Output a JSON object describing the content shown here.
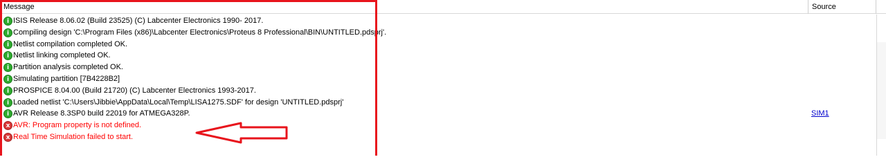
{
  "header": {
    "message_label": "Message",
    "source_label": "Source"
  },
  "messages": [
    {
      "type": "info",
      "text": "ISIS Release 8.06.02 (Build 23525) (C) Labcenter Electronics 1990- 2017.",
      "source": ""
    },
    {
      "type": "info",
      "text": "Compiling design 'C:\\Program Files (x86)\\Labcenter Electronics\\Proteus 8 Professional\\BIN\\UNTITLED.pdsprj'.",
      "source": ""
    },
    {
      "type": "info",
      "text": "Netlist compilation completed OK.",
      "source": ""
    },
    {
      "type": "info",
      "text": "Netlist linking completed OK.",
      "source": ""
    },
    {
      "type": "info",
      "text": "Partition analysis completed OK.",
      "source": ""
    },
    {
      "type": "info",
      "text": "Simulating partition [7B4228B2]",
      "source": ""
    },
    {
      "type": "info",
      "text": "PROSPICE 8.04.00 (Build 21720) (C) Labcenter Electronics 1993-2017.",
      "source": ""
    },
    {
      "type": "info",
      "text": "Loaded netlist 'C:\\Users\\Jibbie\\AppData\\Local\\Temp\\LISA1275.SDF' for design 'UNTITLED.pdsprj'",
      "source": ""
    },
    {
      "type": "info",
      "text": "AVR Release 8.3SP0 build 22019 for ATMEGA328P.",
      "source": "SIM1"
    },
    {
      "type": "error",
      "text": "AVR: Program property is not defined.",
      "source": ""
    },
    {
      "type": "error",
      "text": "Real Time Simulation failed to start.",
      "source": ""
    }
  ],
  "icons": {
    "info": "i",
    "error": "x"
  },
  "colors": {
    "annotation": "#e8141c",
    "error_text": "#ff0000",
    "info_icon": "#2eaa2e",
    "error_icon": "#d83a3a",
    "link": "#0000cc"
  }
}
